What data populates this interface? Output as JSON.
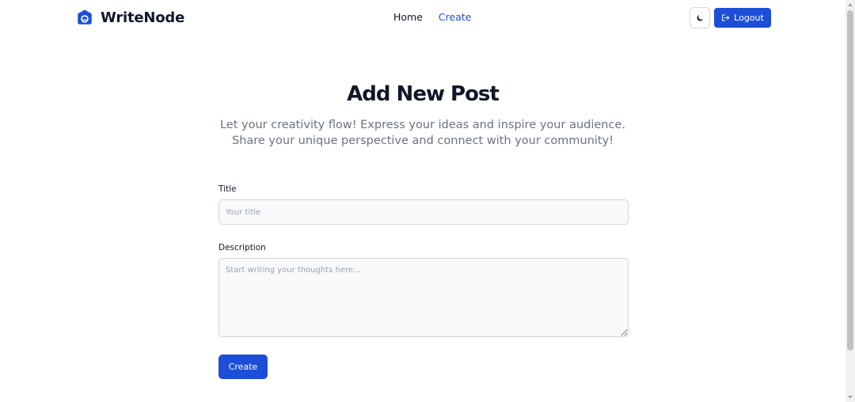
{
  "brand": {
    "name": "WriteNode",
    "icon": "robot-logo-icon"
  },
  "nav": {
    "home_label": "Home",
    "create_label": "Create"
  },
  "header_actions": {
    "theme_icon": "moon-icon",
    "logout_label": "Logout",
    "logout_icon": "logout-icon"
  },
  "hero": {
    "title": "Add New Post",
    "subtitle_line1": "Let your creativity flow! Express your ideas and inspire your audience.",
    "subtitle_line2": "Share your unique perspective and connect with your community!"
  },
  "form": {
    "title_label": "Title",
    "title_placeholder": "Your title",
    "title_value": "",
    "description_label": "Description",
    "description_placeholder": "Start writing your thoughts here...",
    "description_value": "",
    "submit_label": "Create"
  },
  "colors": {
    "primary": "#1d4ed8",
    "text_dark": "#0f172a",
    "text_muted": "#6b7280",
    "input_bg": "#f8f9fb",
    "input_border": "#d1d5db"
  }
}
